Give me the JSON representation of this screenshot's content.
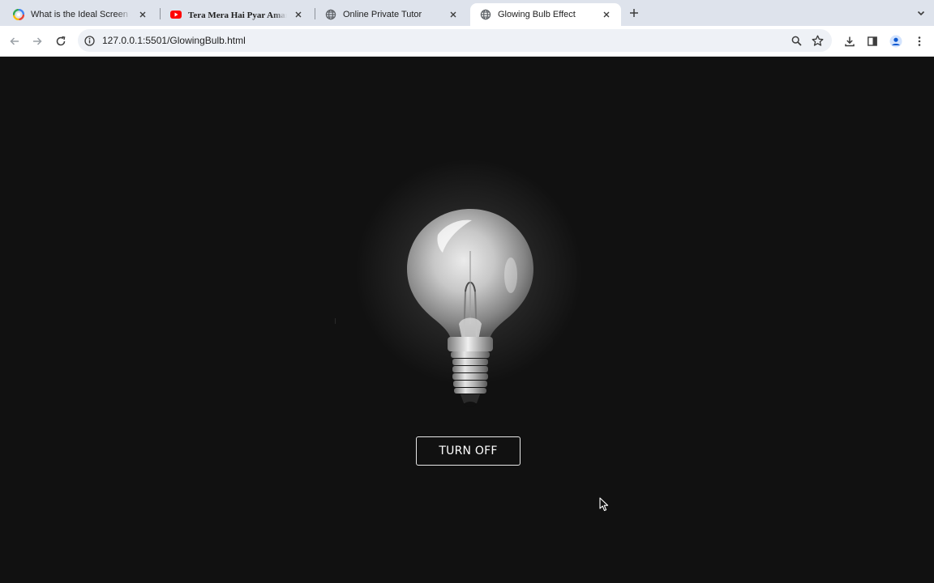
{
  "browser": {
    "tabs": [
      {
        "title": "What is the Ideal Screen Size",
        "favicon": "google-icon",
        "active": false
      },
      {
        "title": "Tera Mera Hai Pyar Amar❤️Ish",
        "favicon": "youtube-icon",
        "active": false
      },
      {
        "title": "Online Private Tutor",
        "favicon": "globe-icon",
        "active": false
      },
      {
        "title": "Glowing Bulb Effect",
        "favicon": "globe-icon",
        "active": true
      }
    ],
    "url": "127.0.0.1:5501/GlowingBulb.html",
    "colors": {
      "tabstrip": "#dee3ec",
      "toolbar": "#ffffff",
      "omnibox": "#eef1f6"
    }
  },
  "page": {
    "background": "#111111",
    "button_label": "TURN OFF",
    "bulb_state": "on"
  }
}
